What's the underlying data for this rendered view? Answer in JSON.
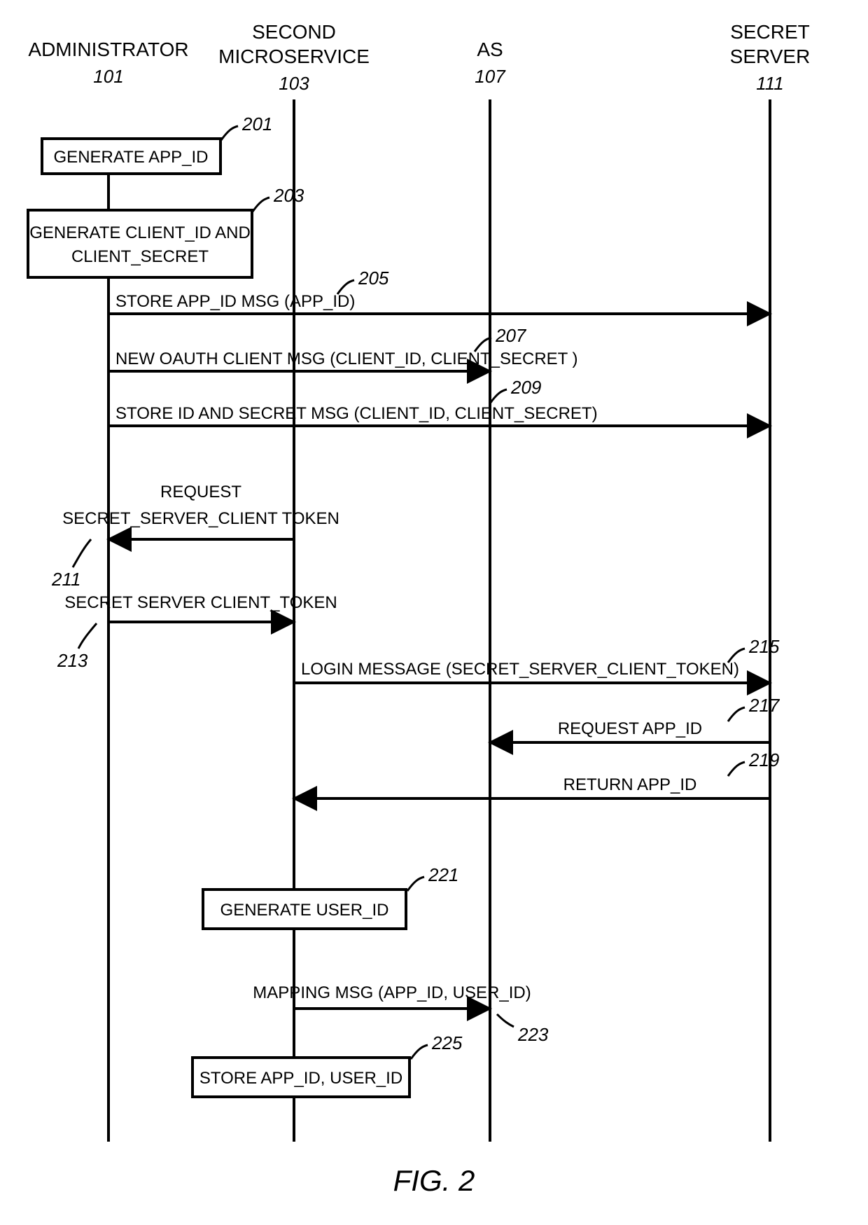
{
  "figure_caption": "FIG. 2",
  "lanes": {
    "admin": {
      "label1": "ADMINISTRATOR",
      "label2": "",
      "id": "101"
    },
    "ms2": {
      "label1": "SECOND",
      "label2": "MICROSERVICE",
      "id": "103"
    },
    "as": {
      "label1": "AS",
      "label2": "",
      "id": "107"
    },
    "secret": {
      "label1": "SECRET",
      "label2": "SERVER",
      "id": "111"
    }
  },
  "boxes": {
    "b201": {
      "line1": "GENERATE APP_ID",
      "line2": "",
      "ref": "201"
    },
    "b203": {
      "line1": "GENERATE CLIENT_ID AND",
      "line2": "CLIENT_SECRET",
      "ref": "203"
    },
    "b221": {
      "line1": "GENERATE USER_ID",
      "line2": "",
      "ref": "221"
    },
    "b225": {
      "line1": "STORE APP_ID, USER_ID",
      "line2": "",
      "ref": "225"
    }
  },
  "messages": {
    "m205": {
      "text": "STORE APP_ID MSG (APP_ID)",
      "ref": "205"
    },
    "m207": {
      "text": "NEW OAUTH CLIENT MSG (CLIENT_ID, CLIENT_SECRET )",
      "ref": "207"
    },
    "m209": {
      "text": "STORE ID AND SECRET MSG (CLIENT_ID, CLIENT_SECRET)",
      "ref": "209"
    },
    "m211": {
      "line1": "REQUEST",
      "line2": "SECRET_SERVER_CLIENT TOKEN",
      "ref": "211"
    },
    "m213": {
      "text": "SECRET SERVER CLIENT_TOKEN",
      "ref": "213"
    },
    "m215": {
      "text": "LOGIN MESSAGE (SECRET_SERVER_CLIENT_TOKEN)",
      "ref": "215"
    },
    "m217": {
      "text": "REQUEST APP_ID",
      "ref": "217"
    },
    "m219": {
      "text": "RETURN APP_ID",
      "ref": "219"
    },
    "m223": {
      "text": "MAPPING MSG (APP_ID, USER_ID)",
      "ref": "223"
    }
  }
}
